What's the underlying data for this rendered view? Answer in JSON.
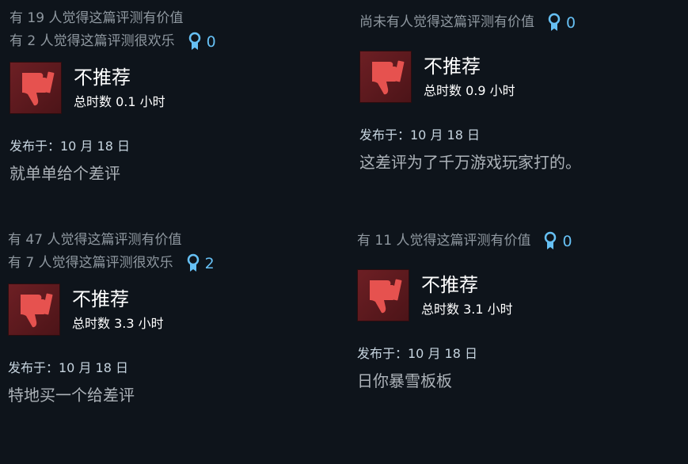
{
  "reviews": [
    {
      "helpful_line": "有 19 人觉得这篇评测有价值",
      "funny_line": "有 2 人觉得这篇评测很欢乐",
      "award_count": "0",
      "verdict": "不推荐",
      "playtime": "总时数 0.1 小时",
      "posted": "发布于：10 月 18 日",
      "text": "就单单给个差评"
    },
    {
      "helpful_line": "尚未有人觉得这篇评测有价值",
      "funny_line": "",
      "award_count": "0",
      "verdict": "不推荐",
      "playtime": "总时数 0.9 小时",
      "posted": "发布于：10 月 18 日",
      "text": "这差评为了千万游戏玩家打的。"
    },
    {
      "helpful_line": "有 47 人觉得这篇评测有价值",
      "funny_line": "有 7 人觉得这篇评测很欢乐",
      "award_count": "2",
      "verdict": "不推荐",
      "playtime": "总时数 3.3 小时",
      "posted": "发布于：10 月 18 日",
      "text": "特地买一个给差评"
    },
    {
      "helpful_line": "有 11 人觉得这篇评测有价值",
      "funny_line": "",
      "award_count": "0",
      "verdict": "不推荐",
      "playtime": "总时数 3.1 小时",
      "posted": "发布于：10 月 18 日",
      "text": "日你暴雪板板"
    }
  ],
  "icons": {
    "thumb": "thumbs-down-icon",
    "award": "award-ribbon-icon"
  },
  "colors": {
    "background": "#0e141b",
    "muted_text": "#8f98a0",
    "award_blue": "#66c0f4",
    "thumb_red": "#e6524f",
    "thumb_box": "#6d1f24"
  }
}
